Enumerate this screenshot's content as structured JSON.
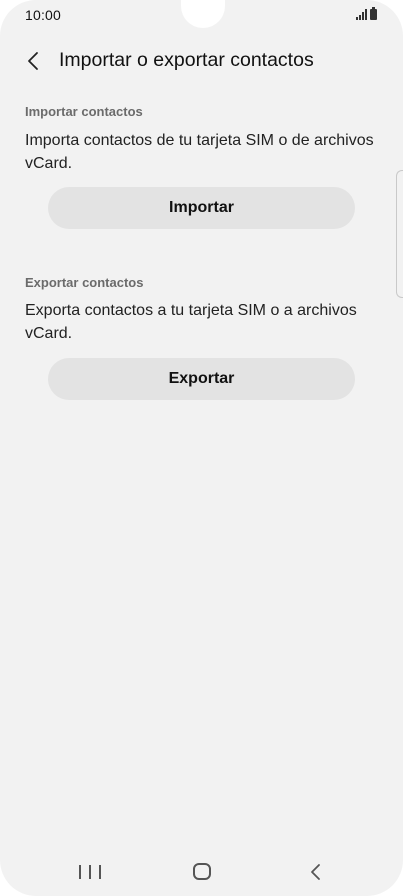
{
  "status_bar": {
    "time": "10:00"
  },
  "header": {
    "title": "Importar o exportar contactos",
    "back_icon": "chevron-left-icon"
  },
  "import_section": {
    "label": "Importar contactos",
    "description": "Importa contactos de tu tarjeta SIM o de archivos vCard.",
    "button_label": "Importar"
  },
  "export_section": {
    "label": "Exportar contactos",
    "description": "Exporta contactos a tu tarjeta SIM o a archivos vCard.",
    "button_label": "Exportar"
  },
  "nav_bar": {
    "recents_icon": "recents-icon",
    "home_icon": "home-icon",
    "back_icon": "back-icon"
  },
  "colors": {
    "background": "#f2f2f2",
    "button": "#e3e3e3",
    "text_primary": "#111111",
    "text_secondary": "#6b6b6b"
  }
}
